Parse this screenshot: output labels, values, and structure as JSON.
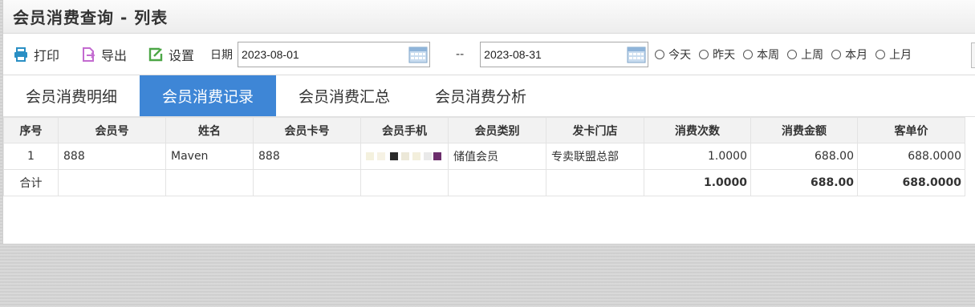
{
  "header": {
    "title": "会员消费查询 - 列表"
  },
  "toolbar": {
    "print_label": "打印",
    "export_label": "导出",
    "settings_label": "设置",
    "date_label": "日期",
    "date_from": "2023-08-01",
    "date_sep": "--",
    "date_to": "2023-08-31",
    "ranges": [
      "今天",
      "昨天",
      "本周",
      "上周",
      "本月",
      "上月"
    ]
  },
  "tabs": [
    "会员消费明细",
    "会员消费记录",
    "会员消费汇总",
    "会员消费分析"
  ],
  "active_tab": "会员消费记录",
  "table": {
    "columns": [
      "序号",
      "会员号",
      "姓名",
      "会员卡号",
      "会员手机",
      "会员类别",
      "发卡门店",
      "消费次数",
      "消费金额",
      "客单价"
    ],
    "rows": [
      {
        "seq": "1",
        "member_no": "888",
        "name": "Maven",
        "card_no": "888",
        "phone": "",
        "category": "储值会员",
        "store": "专卖联盟总部",
        "count": "1.0000",
        "amount": "688.00",
        "avg": "688.0000"
      }
    ],
    "total": {
      "label": "合计",
      "count": "1.0000",
      "amount": "688.00",
      "avg": "688.0000"
    }
  },
  "colors": {
    "accent": "#3e86d6",
    "print_icon": "#2a8fc4",
    "export_icon": "#c36bd0",
    "settings_icon": "#4ca646"
  }
}
